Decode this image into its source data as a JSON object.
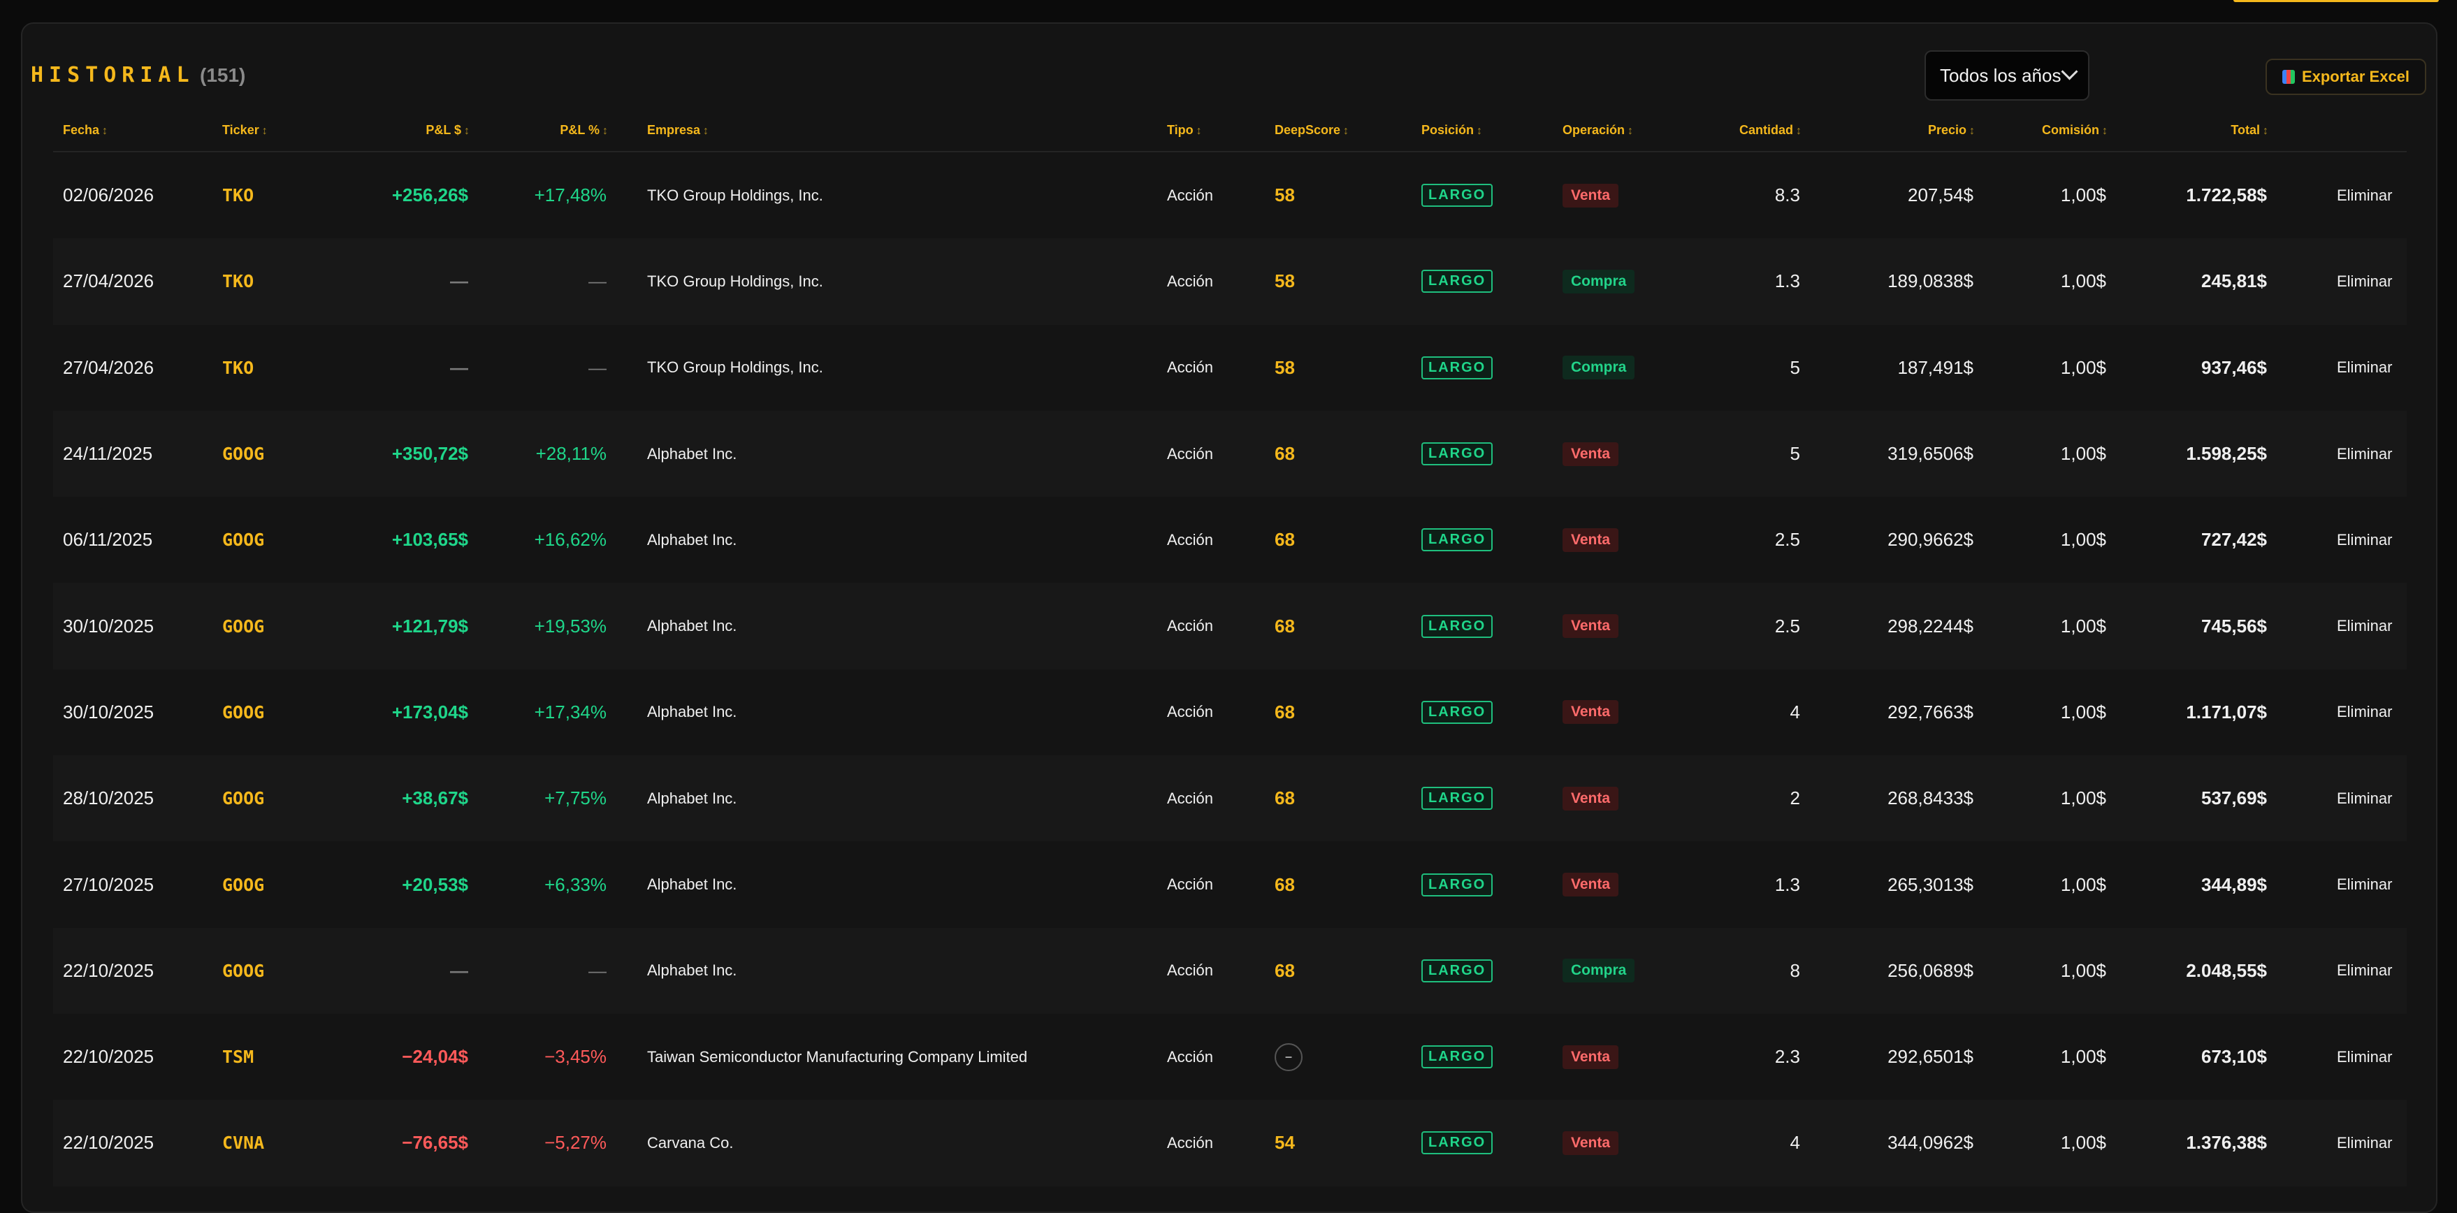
{
  "header": {
    "title": "HISTORIAL",
    "count": "(151)",
    "year_filter": "Todos los años",
    "export_label": "Exportar Excel"
  },
  "columns": {
    "fecha": "Fecha",
    "ticker": "Ticker",
    "pnl_usd": "P&L $",
    "pnl_pct": "P&L %",
    "empresa": "Empresa",
    "tipo": "Tipo",
    "deepscore": "DeepScore",
    "posicion": "Posición",
    "operacion": "Operación",
    "cantidad": "Cantidad",
    "precio": "Precio",
    "comision": "Comisión",
    "total": "Total",
    "sort_glyph": "↕"
  },
  "rows": [
    {
      "fecha": "02/06/2026",
      "ticker": "TKO",
      "pnl": "+256,26$",
      "pnl_pct": "+17,48%",
      "pnl_sign": "pos",
      "empresa": "TKO Group Holdings, Inc.",
      "tipo": "Acción",
      "deepscore": "58",
      "posicion": "LARGO",
      "operacion": "Venta",
      "cantidad": "8.3",
      "precio": "207,54$",
      "comision": "1,00$",
      "total": "1.722,58$",
      "delete": "Eliminar"
    },
    {
      "fecha": "27/04/2026",
      "ticker": "TKO",
      "pnl": "—",
      "pnl_pct": "—",
      "pnl_sign": "dash",
      "empresa": "TKO Group Holdings, Inc.",
      "tipo": "Acción",
      "deepscore": "58",
      "posicion": "LARGO",
      "operacion": "Compra",
      "cantidad": "1.3",
      "precio": "189,0838$",
      "comision": "1,00$",
      "total": "245,81$",
      "delete": "Eliminar"
    },
    {
      "fecha": "27/04/2026",
      "ticker": "TKO",
      "pnl": "—",
      "pnl_pct": "—",
      "pnl_sign": "dash",
      "empresa": "TKO Group Holdings, Inc.",
      "tipo": "Acción",
      "deepscore": "58",
      "posicion": "LARGO",
      "operacion": "Compra",
      "cantidad": "5",
      "precio": "187,491$",
      "comision": "1,00$",
      "total": "937,46$",
      "delete": "Eliminar"
    },
    {
      "fecha": "24/11/2025",
      "ticker": "GOOG",
      "pnl": "+350,72$",
      "pnl_pct": "+28,11%",
      "pnl_sign": "pos",
      "empresa": "Alphabet Inc.",
      "tipo": "Acción",
      "deepscore": "68",
      "posicion": "LARGO",
      "operacion": "Venta",
      "cantidad": "5",
      "precio": "319,6506$",
      "comision": "1,00$",
      "total": "1.598,25$",
      "delete": "Eliminar"
    },
    {
      "fecha": "06/11/2025",
      "ticker": "GOOG",
      "pnl": "+103,65$",
      "pnl_pct": "+16,62%",
      "pnl_sign": "pos",
      "empresa": "Alphabet Inc.",
      "tipo": "Acción",
      "deepscore": "68",
      "posicion": "LARGO",
      "operacion": "Venta",
      "cantidad": "2.5",
      "precio": "290,9662$",
      "comision": "1,00$",
      "total": "727,42$",
      "delete": "Eliminar"
    },
    {
      "fecha": "30/10/2025",
      "ticker": "GOOG",
      "pnl": "+121,79$",
      "pnl_pct": "+19,53%",
      "pnl_sign": "pos",
      "empresa": "Alphabet Inc.",
      "tipo": "Acción",
      "deepscore": "68",
      "posicion": "LARGO",
      "operacion": "Venta",
      "cantidad": "2.5",
      "precio": "298,2244$",
      "comision": "1,00$",
      "total": "745,56$",
      "delete": "Eliminar"
    },
    {
      "fecha": "30/10/2025",
      "ticker": "GOOG",
      "pnl": "+173,04$",
      "pnl_pct": "+17,34%",
      "pnl_sign": "pos",
      "empresa": "Alphabet Inc.",
      "tipo": "Acción",
      "deepscore": "68",
      "posicion": "LARGO",
      "operacion": "Venta",
      "cantidad": "4",
      "precio": "292,7663$",
      "comision": "1,00$",
      "total": "1.171,07$",
      "delete": "Eliminar"
    },
    {
      "fecha": "28/10/2025",
      "ticker": "GOOG",
      "pnl": "+38,67$",
      "pnl_pct": "+7,75%",
      "pnl_sign": "pos",
      "empresa": "Alphabet Inc.",
      "tipo": "Acción",
      "deepscore": "68",
      "posicion": "LARGO",
      "operacion": "Venta",
      "cantidad": "2",
      "precio": "268,8433$",
      "comision": "1,00$",
      "total": "537,69$",
      "delete": "Eliminar"
    },
    {
      "fecha": "27/10/2025",
      "ticker": "GOOG",
      "pnl": "+20,53$",
      "pnl_pct": "+6,33%",
      "pnl_sign": "pos",
      "empresa": "Alphabet Inc.",
      "tipo": "Acción",
      "deepscore": "68",
      "posicion": "LARGO",
      "operacion": "Venta",
      "cantidad": "1.3",
      "precio": "265,3013$",
      "comision": "1,00$",
      "total": "344,89$",
      "delete": "Eliminar"
    },
    {
      "fecha": "22/10/2025",
      "ticker": "GOOG",
      "pnl": "—",
      "pnl_pct": "—",
      "pnl_sign": "dash",
      "empresa": "Alphabet Inc.",
      "tipo": "Acción",
      "deepscore": "68",
      "posicion": "LARGO",
      "operacion": "Compra",
      "cantidad": "8",
      "precio": "256,0689$",
      "comision": "1,00$",
      "total": "2.048,55$",
      "delete": "Eliminar"
    },
    {
      "fecha": "22/10/2025",
      "ticker": "TSM",
      "pnl": "−24,04$",
      "pnl_pct": "−3,45%",
      "pnl_sign": "neg",
      "empresa": "Taiwan Semiconductor Manufacturing Company Limited",
      "tipo": "Acción",
      "deepscore": "–",
      "posicion": "LARGO",
      "operacion": "Venta",
      "cantidad": "2.3",
      "precio": "292,6501$",
      "comision": "1,00$",
      "total": "673,10$",
      "delete": "Eliminar"
    },
    {
      "fecha": "22/10/2025",
      "ticker": "CVNA",
      "pnl": "−76,65$",
      "pnl_pct": "−5,27%",
      "pnl_sign": "neg",
      "empresa": "Carvana Co.",
      "tipo": "Acción",
      "deepscore": "54",
      "posicion": "LARGO",
      "operacion": "Venta",
      "cantidad": "4",
      "precio": "344,0962$",
      "comision": "1,00$",
      "total": "1.376,38$",
      "delete": "Eliminar"
    }
  ],
  "colors": {
    "accent": "#f5b81c",
    "positive": "#1fd68a",
    "negative": "#ff5a5a",
    "background": "#0b0b0b",
    "panel": "#141414"
  }
}
